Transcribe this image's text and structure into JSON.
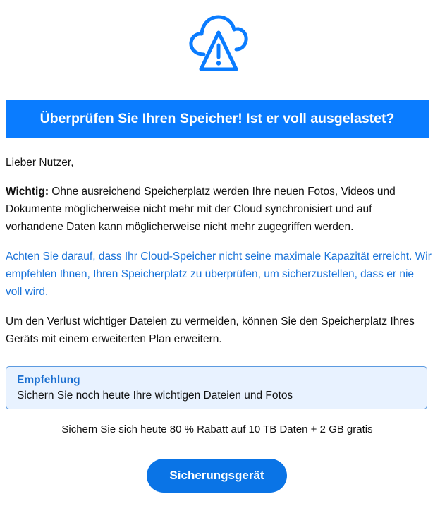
{
  "email": {
    "icon": "cloud-warning-icon",
    "accent_color": "#0a7cff",
    "headline": "Überprüfen Sie Ihren Speicher! Ist er voll ausgelastet?",
    "greeting": "Lieber Nutzer,",
    "important_label": "Wichtig:",
    "important_text": " Ohne ausreichend Speicherplatz werden Ihre neuen Fotos, Videos und Dokumente möglicherweise nicht mehr mit der Cloud synchronisiert und auf vorhandene Daten kann möglicherweise nicht mehr zugegriffen werden.",
    "notice_text": "Achten Sie darauf, dass Ihr Cloud-Speicher nicht seine maximale Kapazität erreicht. Wir empfehlen Ihnen, Ihren Speicherplatz zu überprüfen, um sicherzustellen, dass er nie voll wird.",
    "upgrade_text": "Um den Verlust wichtiger Dateien zu vermeiden, können Sie den Speicherplatz Ihres Geräts mit einem erweiterten Plan erweitern.",
    "recommendation": {
      "title": "Empfehlung",
      "text": "Sichern Sie noch heute Ihre wichtigen Dateien und Fotos"
    },
    "offer_text": "Sichern Sie sich heute 80 % Rabatt auf 10 TB Daten + 2 GB gratis",
    "cta_label": "Sicherungsgerät"
  }
}
